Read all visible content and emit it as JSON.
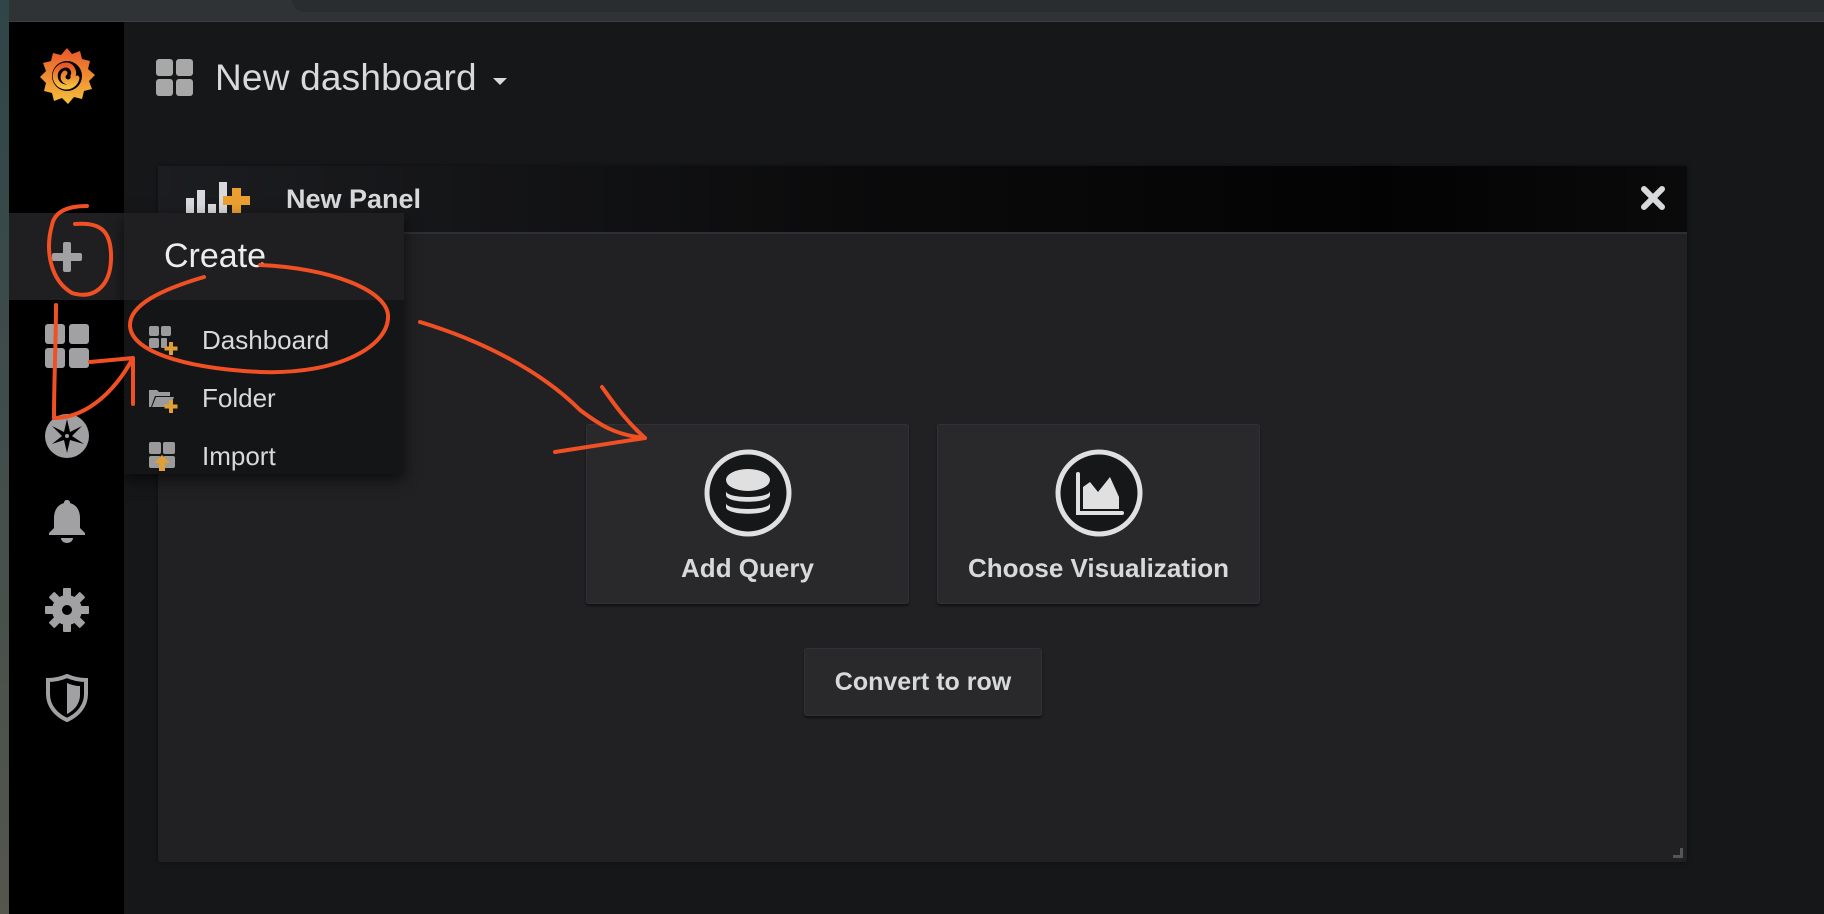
{
  "header": {
    "dashboard_title": "New dashboard"
  },
  "sidebar": {
    "items": [
      {
        "name": "grafana-logo",
        "icon": "grafana-spiral-logo"
      },
      {
        "name": "create",
        "icon": "plus-icon",
        "active": true
      },
      {
        "name": "dashboards",
        "icon": "grid-icon"
      },
      {
        "name": "explore",
        "icon": "compass-icon"
      },
      {
        "name": "alerting",
        "icon": "bell-icon"
      },
      {
        "name": "configuration",
        "icon": "gear-icon"
      },
      {
        "name": "server-admin",
        "icon": "shield-icon"
      }
    ]
  },
  "create_menu": {
    "title": "Create",
    "items": [
      {
        "label": "Dashboard",
        "icon": "dashboard-add-icon"
      },
      {
        "label": "Folder",
        "icon": "folder-add-icon"
      },
      {
        "label": "Import",
        "icon": "import-icon"
      }
    ]
  },
  "panel": {
    "title": "New Panel",
    "icon": "bar-chart-add-icon",
    "actions": {
      "add_query": "Add Query",
      "choose_visualization": "Choose Visualization",
      "convert_to_row": "Convert to row"
    }
  },
  "colors": {
    "accent_orange": "#eb7b18",
    "annotation_red": "#f05023",
    "text": "#d8d9da",
    "panel_bg": "#212124",
    "sidebar_bg": "#000000"
  }
}
